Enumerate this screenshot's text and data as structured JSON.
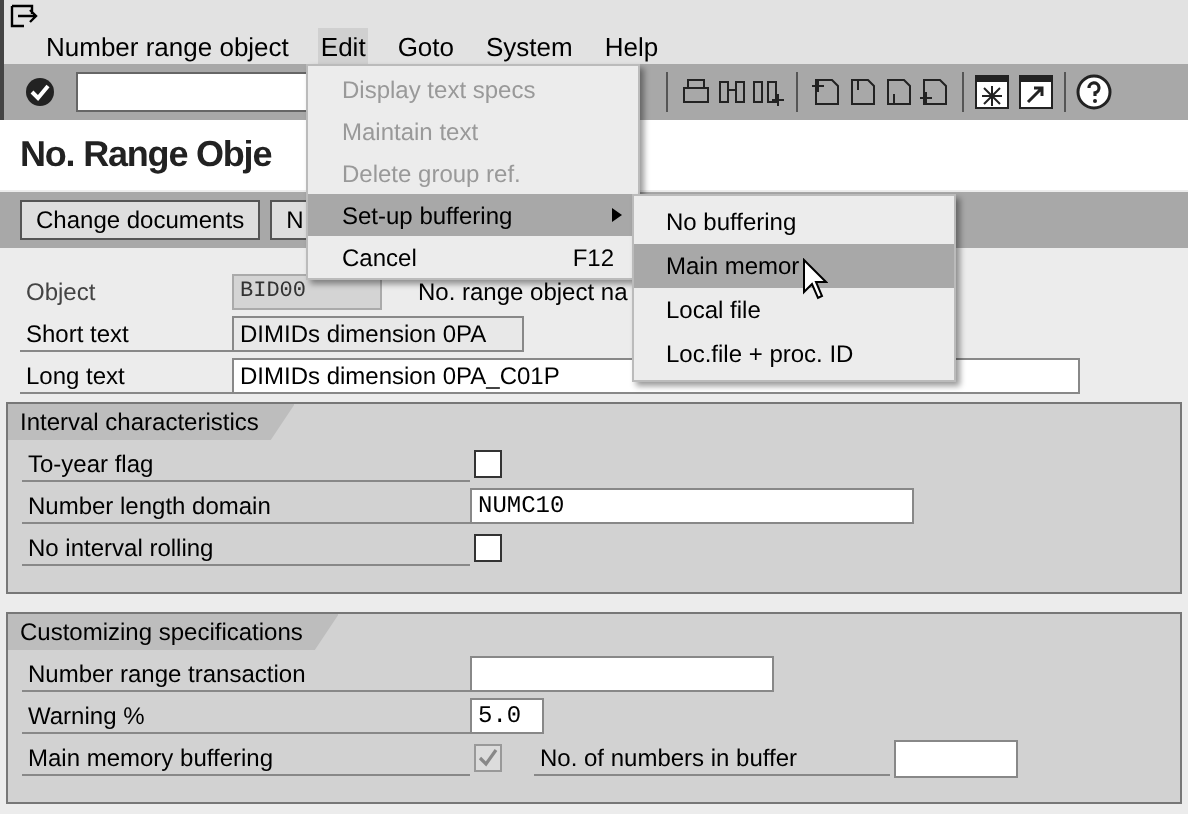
{
  "menu_bar": [
    {
      "label": "Number range object",
      "selected": false
    },
    {
      "label": "Edit",
      "selected": true
    },
    {
      "label": "Goto",
      "selected": false
    },
    {
      "label": "System",
      "selected": false
    },
    {
      "label": "Help",
      "selected": false
    }
  ],
  "title": "No. Range Obje",
  "buttons": [
    "Change documents",
    "N"
  ],
  "header_fields": [
    {
      "kind": "readonly",
      "label": "Object",
      "value": "BID00",
      "note": "No. range object na"
    },
    {
      "kind": "input",
      "label": "Short text",
      "value": "DIMIDs dimension 0PA"
    },
    {
      "kind": "input",
      "label": "Long text",
      "value": "DIMIDs dimension 0PA_C01P"
    }
  ],
  "groups": [
    {
      "title": "Interval characteristics",
      "rows": [
        {
          "kind": "checkbox",
          "label": "To-year flag",
          "checked": false,
          "disabled": false
        },
        {
          "kind": "input",
          "label": "Number length domain",
          "value": "NUMC10"
        },
        {
          "kind": "checkbox",
          "label": "No interval rolling",
          "checked": false,
          "disabled": false
        }
      ]
    },
    {
      "title": "Customizing specifications",
      "rows": [
        {
          "kind": "input",
          "label": "Number range transaction",
          "value": ""
        },
        {
          "kind": "input",
          "label": "Warning %",
          "value": "5.0"
        },
        {
          "kind": "checkbox",
          "label": "Main memory buffering",
          "checked": true,
          "disabled": true,
          "extra_label": "No. of numbers in buffer"
        }
      ]
    }
  ],
  "edit_menu": [
    {
      "label": "Display text specs",
      "disabled": true,
      "selected": false
    },
    {
      "label": "Maintain text",
      "disabled": true,
      "selected": false
    },
    {
      "label": "Delete group ref.",
      "disabled": true,
      "selected": false
    },
    {
      "label": "Set-up buffering",
      "disabled": false,
      "selected": true,
      "submenu": true
    },
    {
      "label": "Cancel",
      "disabled": false,
      "selected": false,
      "shortcut": "F12"
    }
  ],
  "submenu": [
    {
      "label": "No buffering",
      "selected": false
    },
    {
      "label": "Main memor",
      "selected": true
    },
    {
      "label": "Local file",
      "selected": false
    },
    {
      "label": "Loc.file + proc. ID",
      "selected": false
    }
  ]
}
